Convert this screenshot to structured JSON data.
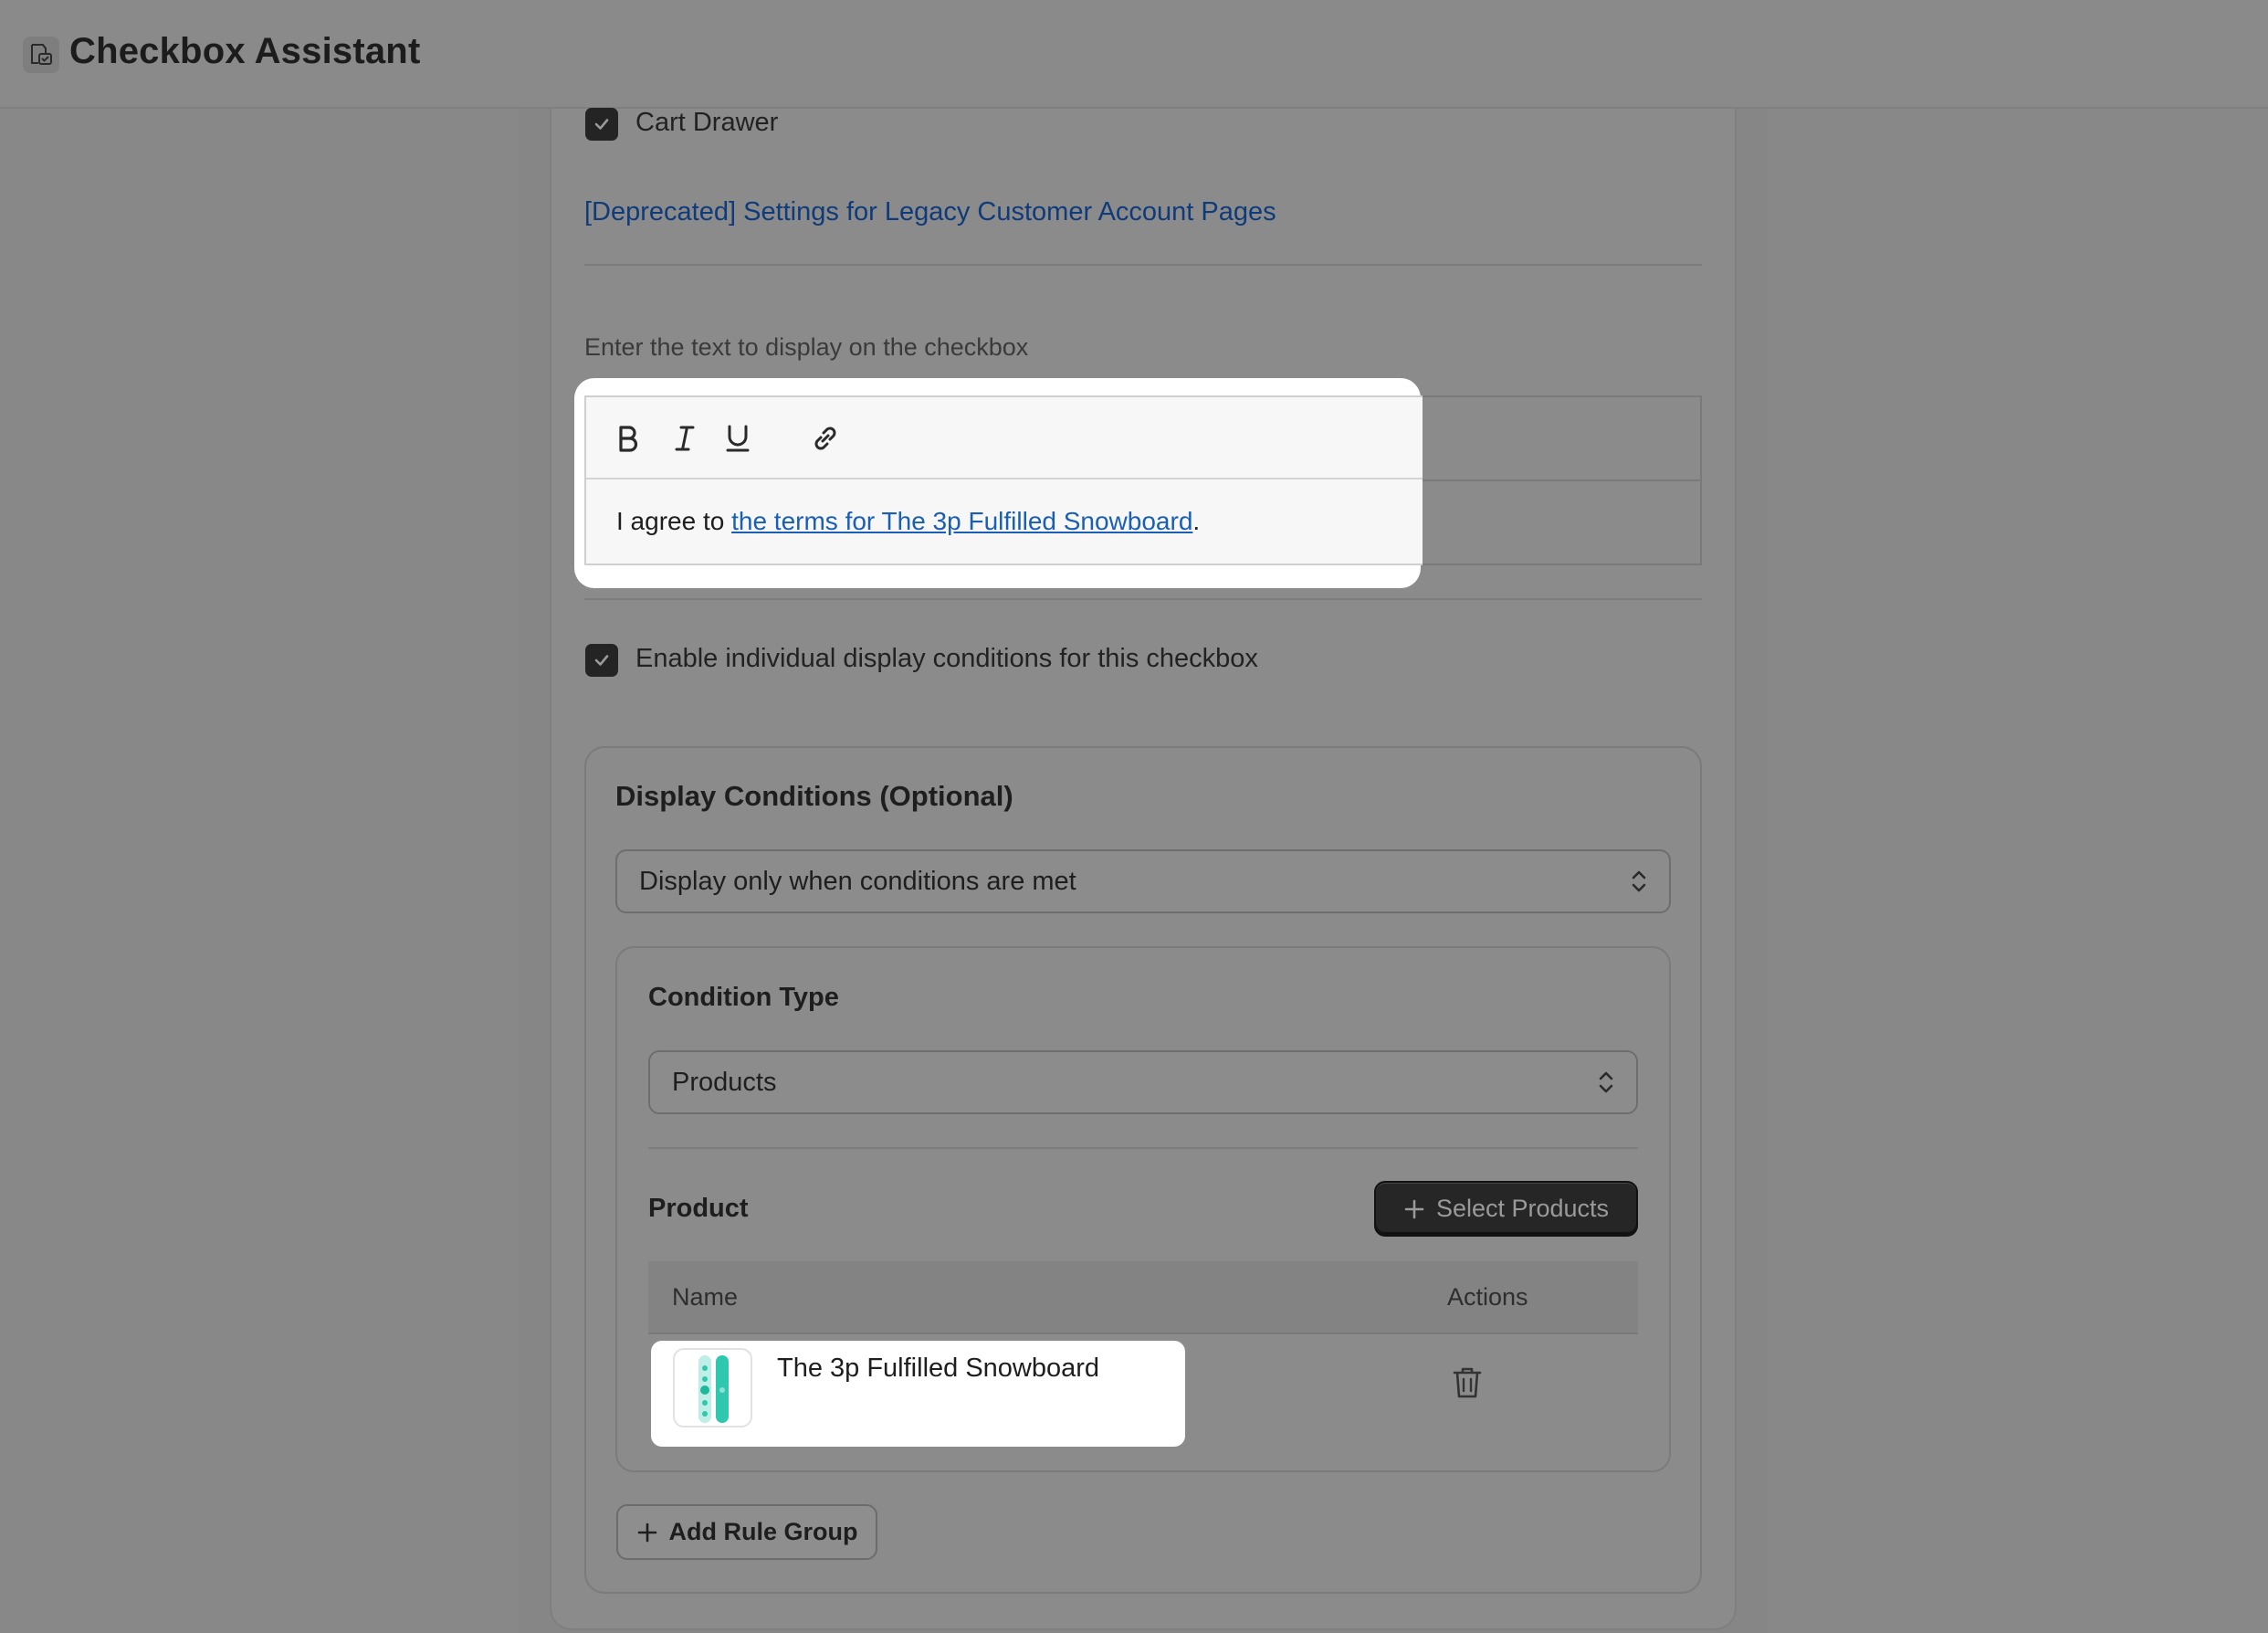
{
  "app": {
    "title": "Checkbox Assistant",
    "icon": "checkbox-assistant-icon"
  },
  "placements": {
    "cart_drawer_label": "Cart Drawer",
    "cart_drawer_checked": true,
    "legacy_link": "[Deprecated] Settings for Legacy Customer Account Pages"
  },
  "editor": {
    "hint": "Enter the text to display on the checkbox",
    "toolbar": [
      "bold-icon",
      "italic-icon",
      "underline-icon",
      "link-icon"
    ],
    "text_prefix": "I agree to ",
    "link_text": "the terms for The 3p Fulfilled Snowboard",
    "text_suffix": "."
  },
  "individual_conditions": {
    "label": "Enable individual display conditions for this checkbox",
    "checked": true
  },
  "display_conditions": {
    "title": "Display Conditions (Optional)",
    "mode_value": "Display only when conditions are met",
    "condition_type_label": "Condition Type",
    "condition_type_value": "Products",
    "product_label": "Product",
    "select_products_label": "Select Products",
    "table": {
      "headers": {
        "name": "Name",
        "actions": "Actions"
      },
      "rows": [
        {
          "name": "The 3p Fulfilled Snowboard"
        }
      ]
    },
    "add_rule_group_label": "Add Rule Group"
  },
  "colors": {
    "link": "#1a5fb4",
    "dark_button": "#262626",
    "overlay": "#888888"
  }
}
